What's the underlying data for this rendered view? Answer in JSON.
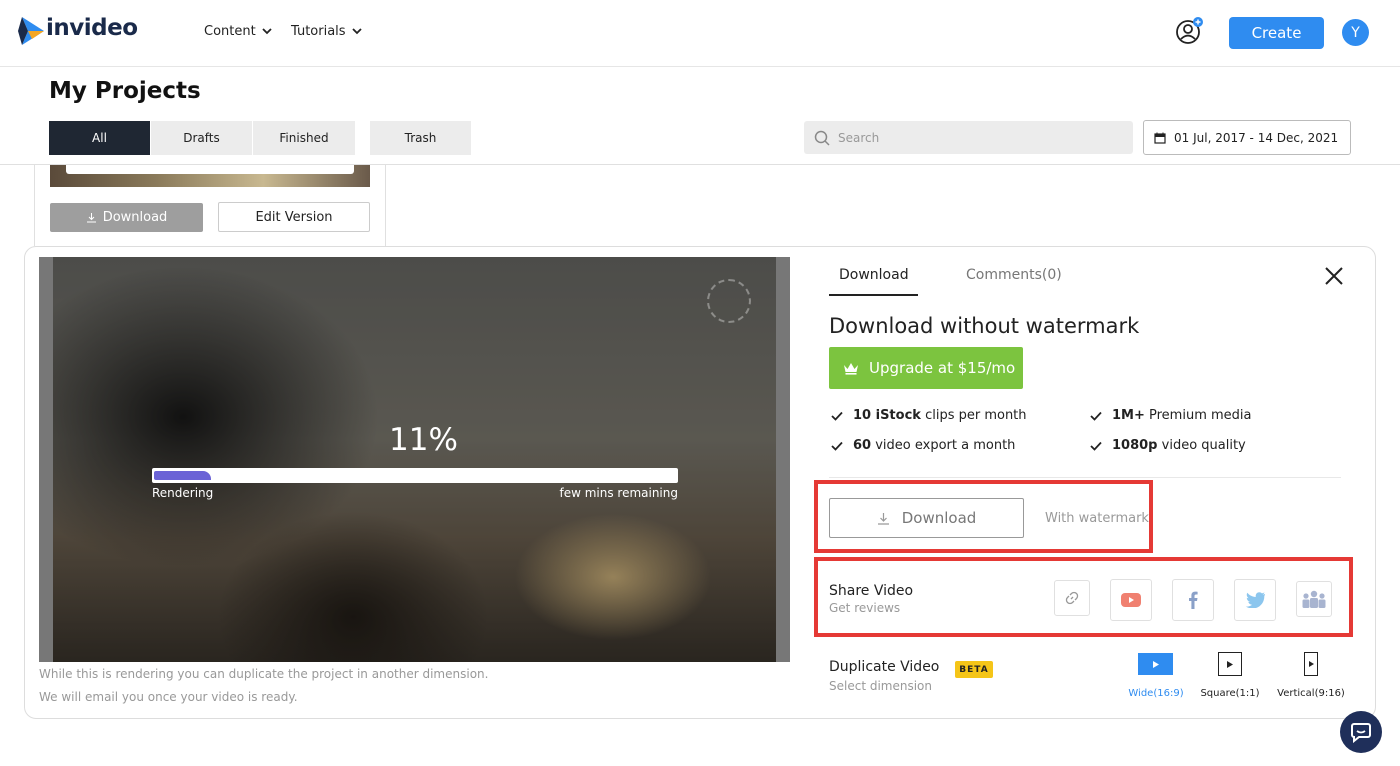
{
  "brand": {
    "name": "invideo"
  },
  "nav": {
    "content": "Content",
    "tutorials": "Tutorials"
  },
  "header": {
    "create_label": "Create",
    "avatar_initial": "Y"
  },
  "page": {
    "title": "My Projects"
  },
  "filters": {
    "all": "All",
    "drafts": "Drafts",
    "finished": "Finished",
    "trash": "Trash"
  },
  "search": {
    "placeholder": "Search"
  },
  "date_range": {
    "value": "01 Jul, 2017 - 14 Dec, 2021"
  },
  "card": {
    "download_label": "Download",
    "edit_label": "Edit Version"
  },
  "render": {
    "percent_text": "11%",
    "progress": 0.11,
    "status": "Rendering",
    "remaining": "few mins remaining",
    "note1": "While this is rendering you can duplicate the project in another dimension.",
    "note2": "We will email you once your video is ready."
  },
  "panel": {
    "tab_download": "Download",
    "tab_comments": "Comments(0)",
    "heading": "Download without watermark",
    "upgrade_label": "Upgrade at $15/mo",
    "features": [
      {
        "bold": "10 iStock",
        "rest": " clips per month"
      },
      {
        "bold": "1M+",
        "rest": " Premium media"
      },
      {
        "bold": "60",
        "rest": " video export a month"
      },
      {
        "bold": "1080p",
        "rest": " video quality"
      }
    ],
    "download_label": "Download",
    "watermark_label": "With watermark",
    "share_title": "Share Video",
    "share_sub": "Get reviews",
    "dup_title": "Duplicate Video",
    "dup_badge": "BETA",
    "dup_sub": "Select dimension",
    "dims": [
      "Wide(16:9)",
      "Square(1:1)",
      "Vertical(9:16)"
    ]
  },
  "colors": {
    "accent": "#2f8cf0",
    "upgrade": "#7cc43f",
    "highlight": "#e53935",
    "dark_tab": "#1f2733"
  }
}
